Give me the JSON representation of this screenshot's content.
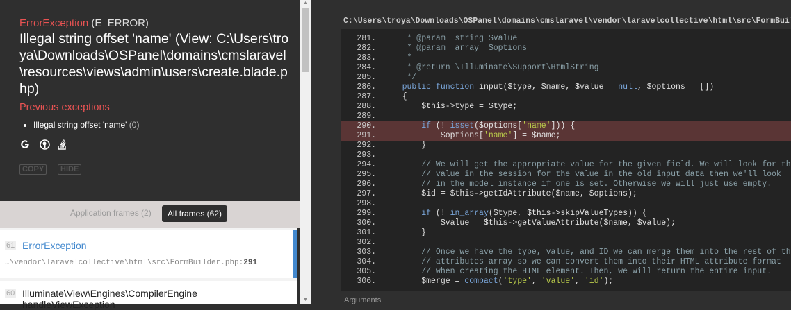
{
  "exception": {
    "class": "ErrorException",
    "code_label": "(E_ERROR)",
    "message": "Illegal string offset 'name' (View: C:\\Users\\troya\\Downloads\\OSPanel\\domains\\cmslaravel\\resources\\views\\admin\\users\\create.blade.php)",
    "previous_title": "Previous exceptions",
    "previous": [
      {
        "message": "Illegal string offset 'name'",
        "code": "(0)"
      }
    ],
    "icons": [
      "google-icon",
      "duckduckgo-icon",
      "stackoverflow-icon"
    ],
    "copy_label": "COPY",
    "hide_label": "HIDE"
  },
  "frames_filter": {
    "app_label": "Application frames (2)",
    "all_label": "All frames (62)"
  },
  "frames": [
    {
      "num": "61",
      "class": "ErrorException",
      "file": "…\\vendor\\laravelcollective\\html\\src\\FormBuilder.php",
      "line": "291"
    },
    {
      "num": "60",
      "class": "Illuminate\\View\\Engines\\CompilerEngine",
      "method": "handleViewException"
    }
  ],
  "code_view": {
    "file_path": "C:\\Users\\troya\\Downloads\\OSPanel\\domains\\cmslaravel\\vendor\\laravelcollective\\html\\src\\FormBuilder.php",
    "lines": [
      {
        "n": "281.",
        "t": "     * @param  string $value"
      },
      {
        "n": "282.",
        "t": "     * @param  array  $options"
      },
      {
        "n": "283.",
        "t": "     *"
      },
      {
        "n": "284.",
        "t": "     * @return \\Illuminate\\Support\\HtmlString"
      },
      {
        "n": "285.",
        "t": "     */"
      },
      {
        "n": "286.",
        "t": "    public function input($type, $name, $value = null, $options = [])"
      },
      {
        "n": "287.",
        "t": "    {"
      },
      {
        "n": "288.",
        "t": "        $this->type = $type;"
      },
      {
        "n": "289.",
        "t": ""
      },
      {
        "n": "290.",
        "t": "        if (! isset($options['name'])) {"
      },
      {
        "n": "291.",
        "t": "            $options['name'] = $name;"
      },
      {
        "n": "292.",
        "t": "        }"
      },
      {
        "n": "293.",
        "t": ""
      },
      {
        "n": "294.",
        "t": "        // We will get the appropriate value for the given field. We will look for the"
      },
      {
        "n": "295.",
        "t": "        // value in the session for the value in the old input data then we'll look"
      },
      {
        "n": "296.",
        "t": "        // in the model instance if one is set. Otherwise we will just use empty."
      },
      {
        "n": "297.",
        "t": "        $id = $this->getIdAttribute($name, $options);"
      },
      {
        "n": "298.",
        "t": ""
      },
      {
        "n": "299.",
        "t": "        if (! in_array($type, $this->skipValueTypes)) {"
      },
      {
        "n": "300.",
        "t": "            $value = $this->getValueAttribute($name, $value);"
      },
      {
        "n": "301.",
        "t": "        }"
      },
      {
        "n": "302.",
        "t": ""
      },
      {
        "n": "303.",
        "t": "        // Once we have the type, value, and ID we can merge them into the rest of the"
      },
      {
        "n": "304.",
        "t": "        // attributes array so we can convert them into their HTML attribute format"
      },
      {
        "n": "305.",
        "t": "        // when creating the HTML element. Then, we will return the entire input."
      },
      {
        "n": "306.",
        "t": "        $merge = compact('type', 'value', 'id');"
      }
    ],
    "arguments_label": "Arguments"
  },
  "colors": {
    "exception_red": "#e95353",
    "accent_blue": "#4288ce",
    "highlight_line": "#5a3535"
  }
}
